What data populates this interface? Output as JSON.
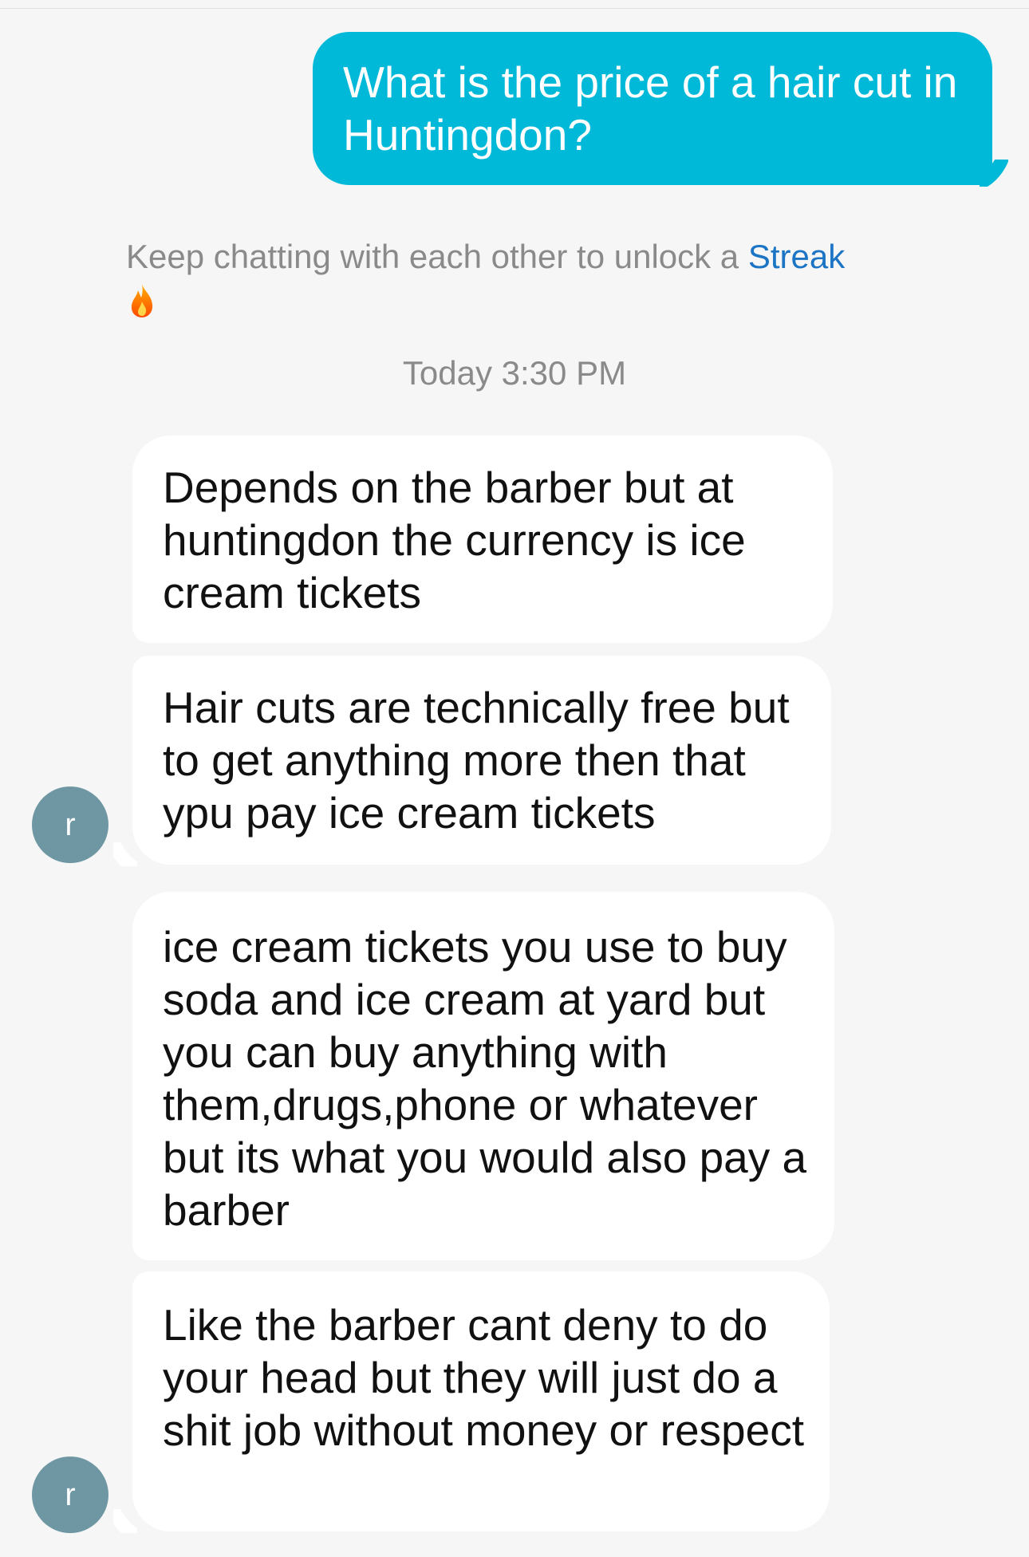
{
  "conversation": {
    "sent_message": "What is the price of a hair cut in Huntingdon?",
    "streak_notice": {
      "text": "Keep chatting with each other to unlock a ",
      "link": "Streak",
      "icon": "fire-icon"
    },
    "timestamp": "Today 3:30 PM",
    "received_messages": [
      {
        "text": "Depends on the barber but at huntingdon the currency is ice cream tickets"
      },
      {
        "text": "Hair cuts are technically free but to get anything more then that ypu pay ice cream tickets"
      },
      {
        "text": "ice cream tickets you use to buy soda and ice cream at yard but you can buy anything with them,drugs,phone or whatever but its what you would also pay a barber"
      },
      {
        "text": "Like the barber cant deny to do your head but they will just do a shit job without money or respect"
      }
    ],
    "contact_avatar_initial": "r"
  },
  "colors": {
    "background": "#f6f6f6",
    "sent_bubble": "#00b9d9",
    "received_bubble": "#ffffff",
    "avatar": "#6f97a3",
    "link": "#1b74c4",
    "muted_text": "#8a8a8a"
  }
}
